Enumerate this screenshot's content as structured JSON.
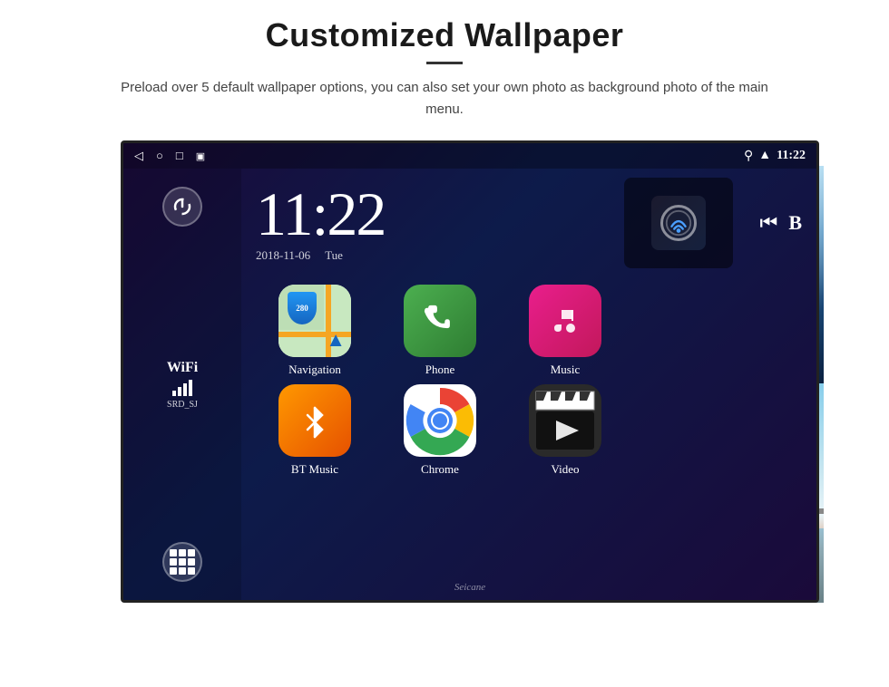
{
  "page": {
    "title": "Customized Wallpaper",
    "description": "Preload over 5 default wallpaper options, you can also set your own photo as background photo of the main menu."
  },
  "status_bar": {
    "time": "11:22",
    "nav_icons": [
      "◁",
      "○",
      "□",
      "▣"
    ],
    "right_icons": [
      "location",
      "wifi",
      "time"
    ]
  },
  "clock": {
    "time": "11:22",
    "date": "2018-11-06",
    "day": "Tue"
  },
  "wifi": {
    "label": "WiFi",
    "ssid": "SRD_SJ"
  },
  "apps": [
    {
      "id": "navigation",
      "label": "Navigation",
      "type": "nav"
    },
    {
      "id": "phone",
      "label": "Phone",
      "type": "phone"
    },
    {
      "id": "music",
      "label": "Music",
      "type": "music"
    },
    {
      "id": "bt_music",
      "label": "BT Music",
      "type": "bt"
    },
    {
      "id": "chrome",
      "label": "Chrome",
      "type": "chrome"
    },
    {
      "id": "video",
      "label": "Video",
      "type": "video"
    }
  ],
  "nav_shield": {
    "number": "280",
    "road_label": "Navigation"
  },
  "wallpaper": {
    "watermark": "Seicane"
  },
  "media": {
    "prev": "⏮",
    "next": "B"
  }
}
